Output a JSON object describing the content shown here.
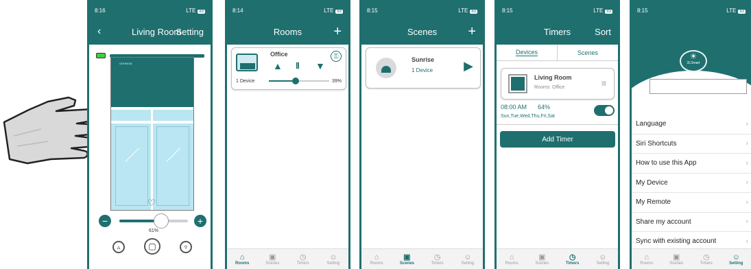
{
  "screen1": {
    "time": "8:16",
    "signal": "LTE",
    "battery": "83",
    "back": "‹",
    "title": "Living Room",
    "setting": "Setting",
    "blind_brand": "OOHBOIA",
    "percent_label": "61%",
    "slider_level": 0.61
  },
  "screen2": {
    "time": "8:14",
    "signal": "LTE",
    "battery": "83",
    "title": "Rooms",
    "add": "+",
    "room": {
      "name": "Office",
      "devices": "1 Device",
      "percent": "39%"
    },
    "tabs": [
      "Rooms",
      "Scenes",
      "Timers",
      "Setting"
    ]
  },
  "screen3": {
    "time": "8:15",
    "signal": "LTE",
    "battery": "83",
    "title": "Scenes",
    "add": "+",
    "scene": {
      "name": "Sunrise",
      "devices": "1 Device"
    },
    "tabs": [
      "Rooms",
      "Scenes",
      "Timers",
      "Setting"
    ]
  },
  "screen4": {
    "time": "8:15",
    "signal": "LTE",
    "battery": "83",
    "title": "Timers",
    "sort": "Sort",
    "seg": [
      "Devices",
      "Scenes"
    ],
    "device": {
      "name": "Living Room",
      "sub": "Rooms: Office"
    },
    "timer": {
      "time": "08:00 AM",
      "percent": "64%",
      "days": "Sun,Tue,Wed,Thu,Fri,Sat"
    },
    "add_timer": "Add Timer",
    "tabs": [
      "Rooms",
      "Scenes",
      "Timers",
      "Setting"
    ]
  },
  "screen5": {
    "time": "8:15",
    "signal": "LTE",
    "battery": "83",
    "logo": "3LSmart",
    "menu": [
      "Language",
      "Siri Shortcuts",
      "How to use this App",
      "My Device",
      "My Remote",
      "Share my account",
      "Sync with existing account"
    ],
    "tabs": [
      "Rooms",
      "Scenes",
      "Timers",
      "Setting"
    ]
  },
  "colors": {
    "primary": "#1f6f6f",
    "glass": "#b9e6f2",
    "hand": "#d9d9d9"
  }
}
